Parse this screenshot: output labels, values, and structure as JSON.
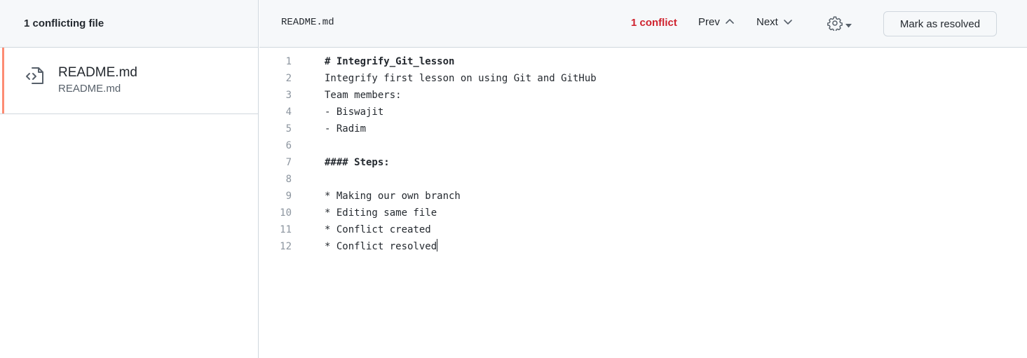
{
  "sidebar": {
    "header": "1 conflicting file",
    "files": [
      {
        "name": "README.md",
        "path": "README.md",
        "icon": "file-code-icon"
      }
    ]
  },
  "toolbar": {
    "filename": "README.md",
    "conflict_count": "1 conflict",
    "prev_label": "Prev",
    "next_label": "Next",
    "resolve_label": "Mark as resolved"
  },
  "editor": {
    "lines": [
      {
        "number": "1",
        "text": "# Integrify_Git_lesson",
        "bold": true
      },
      {
        "number": "2",
        "text": "Integrify first lesson on using Git and GitHub",
        "bold": false
      },
      {
        "number": "3",
        "text": "Team members:",
        "bold": false
      },
      {
        "number": "4",
        "text": "- Biswajit",
        "bold": false
      },
      {
        "number": "5",
        "text": "- Radim",
        "bold": false
      },
      {
        "number": "6",
        "text": "",
        "bold": false
      },
      {
        "number": "7",
        "text": "#### Steps:",
        "bold": true
      },
      {
        "number": "8",
        "text": "",
        "bold": false
      },
      {
        "number": "9",
        "text": "* Making our own branch",
        "bold": false
      },
      {
        "number": "10",
        "text": "* Editing same file",
        "bold": false
      },
      {
        "number": "11",
        "text": "* Conflict created",
        "bold": false
      },
      {
        "number": "12",
        "text": "* Conflict resolved",
        "bold": false
      }
    ]
  },
  "colors": {
    "conflict_red": "#cf222e",
    "active_accent": "#fd8c73",
    "header_bg": "#f6f8fa",
    "border": "#d0d7de"
  }
}
